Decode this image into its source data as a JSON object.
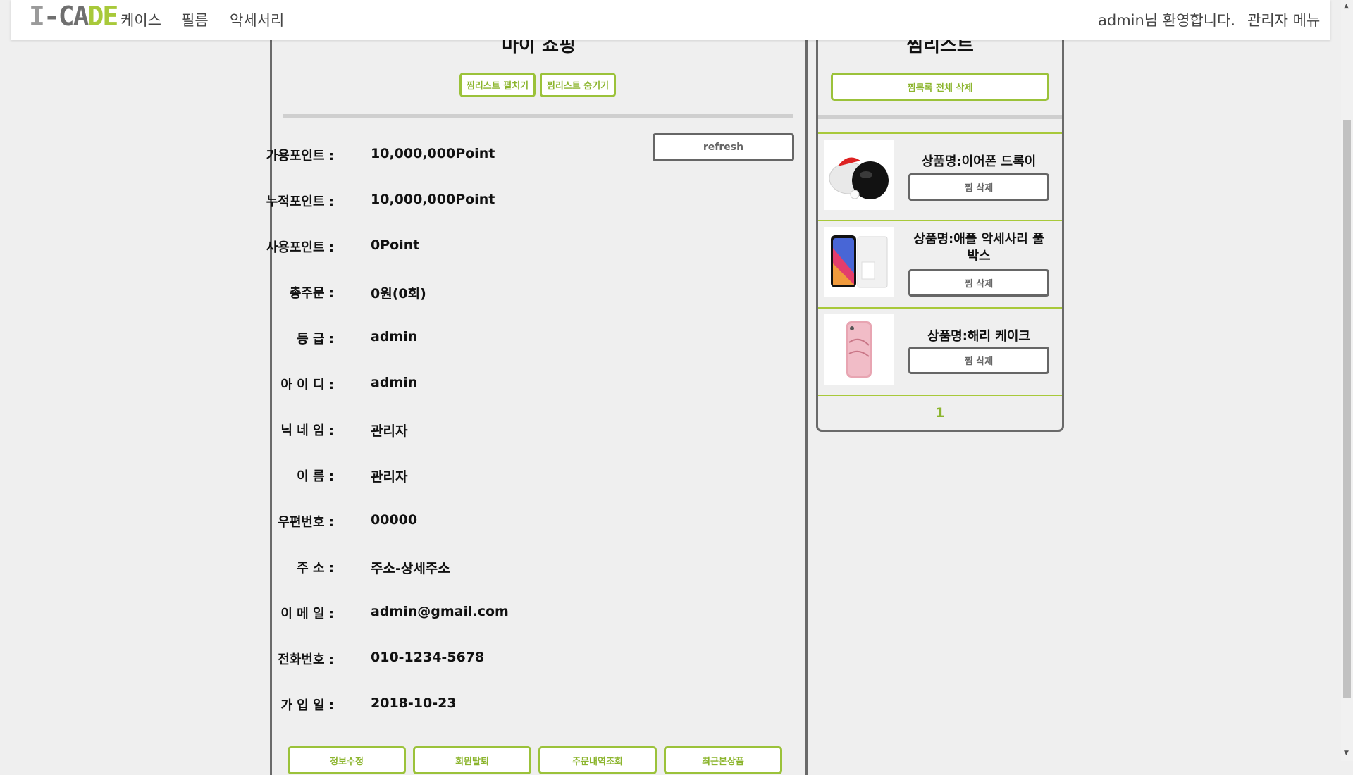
{
  "nav": {
    "logo_part1": "I",
    "logo_part2": "-CA",
    "logo_part3": "DE",
    "items": [
      "케이스",
      "필름",
      "악세서리"
    ],
    "welcome": "admin님 환영합니다.",
    "admin_menu": "관리자 메뉴"
  },
  "main": {
    "title": "마이 쇼핑",
    "show_wishlist": "찜리스트 펼치기",
    "hide_wishlist": "찜리스트 숨기기",
    "refresh": "refresh",
    "rows": [
      {
        "label": "가용포인트 :",
        "value": "10,000,000Point"
      },
      {
        "label": "누적포인트 :",
        "value": "10,000,000Point"
      },
      {
        "label": "사용포인트 :",
        "value": "0Point"
      },
      {
        "label": "총주문 :",
        "value": "0원(0회)"
      },
      {
        "label": "등 급 :",
        "value": "admin"
      },
      {
        "label": "아 이 디 :",
        "value": "admin"
      },
      {
        "label": "닉 네 임 :",
        "value": "관리자"
      },
      {
        "label": "이 름 :",
        "value": "관리자"
      },
      {
        "label": "우편번호 :",
        "value": "00000"
      },
      {
        "label": "주 소 :",
        "value": "주소-상세주소"
      },
      {
        "label": "이 메 일 :",
        "value": "admin@gmail.com"
      },
      {
        "label": "전화번호 :",
        "value": "010-1234-5678"
      },
      {
        "label": "가 입 일 :",
        "value": "2018-10-23"
      }
    ],
    "bottom_buttons": [
      "정보수정",
      "회원탈퇴",
      "주문내역조회",
      "최근본상품"
    ]
  },
  "wishlist": {
    "title": "찜리스트",
    "delete_all": "찜목록 전체 삭제",
    "items": [
      {
        "name": "상품명:이어폰 드록이",
        "delete": "찜 삭제"
      },
      {
        "name": "상품명:애플 악세사리 풀박스",
        "delete": "찜 삭제"
      },
      {
        "name": "상품명:해리 케이크",
        "delete": "찜 삭제"
      }
    ],
    "page": "1"
  },
  "colors": {
    "accent": "#9bc23a",
    "border": "#6a6a6a",
    "background": "#efefef"
  }
}
